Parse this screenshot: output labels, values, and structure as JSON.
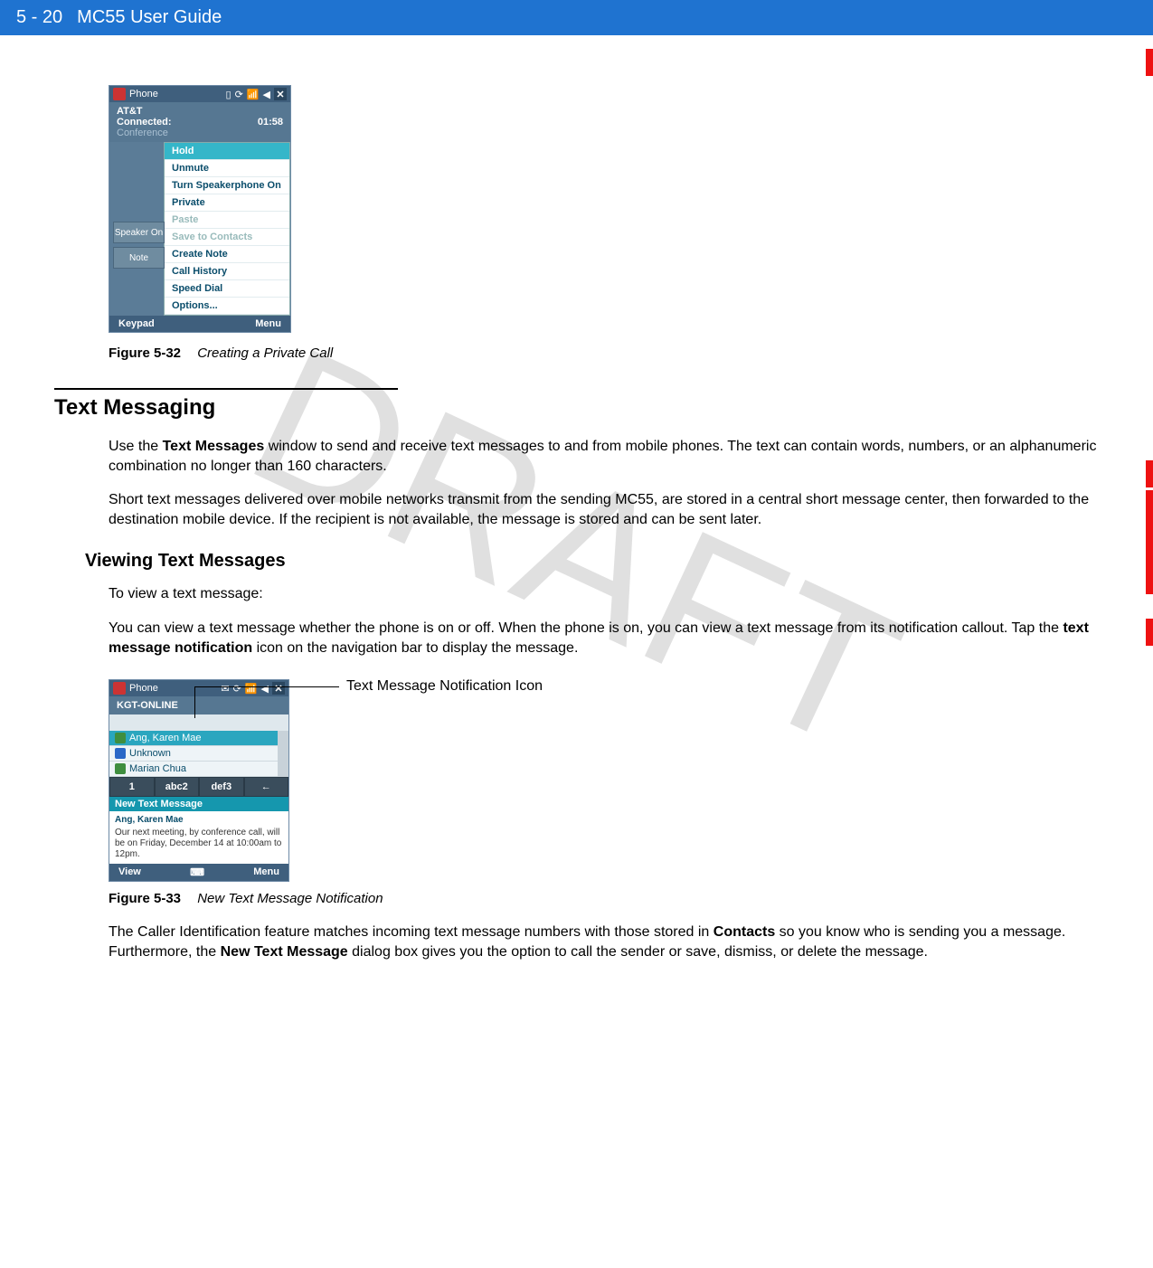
{
  "header": {
    "section": "5 - 20",
    "title": "MC55 User Guide"
  },
  "watermark": "DRAFT",
  "fig32": {
    "title": "Phone",
    "carrier": "AT&T",
    "connected": "Connected:",
    "time": "01:58",
    "conference": "Conference",
    "menu": [
      "Hold",
      "Unmute",
      "Turn Speakerphone On",
      "Private",
      "Paste",
      "Save to Contacts",
      "Create Note",
      "Call History",
      "Speed Dial",
      "Options..."
    ],
    "speaker": "Speaker On",
    "note": "Note",
    "keypad": "Keypad",
    "menubtn": "Menu",
    "caption_num": "Figure 5-32",
    "caption_txt": "Creating a Private Call"
  },
  "section_h": "Text Messaging",
  "p1a": "Use the ",
  "p1b": "Text Messages",
  "p1c": " window to send and receive text messages to and from mobile phones. The text can contain words, numbers, or an alphanumeric combination no longer than 160 characters.",
  "p2": "Short text messages delivered over mobile networks transmit from the sending MC55, are stored in a central short message center, then forwarded to the destination mobile device. If the recipient is not available, the message is stored and can be sent later.",
  "sub_h": "Viewing Text Messages",
  "p3": "To view a text message:",
  "p4a": "You can view a text message whether the phone is on or off. When the phone is on, you can view a text message from its notification callout. Tap the ",
  "p4b": "text message notification",
  "p4c": " icon on the navigation bar to display the message.",
  "callout": "Text Message Notification Icon",
  "fig33": {
    "title": "Phone",
    "kgt": "KGT-ONLINE",
    "contacts": [
      "Ang, Karen Mae",
      "Unknown",
      "Marian Chua"
    ],
    "keys": [
      "1",
      "abc2",
      "def3",
      "←"
    ],
    "newmsg_hdr": "New Text Message",
    "from": "Ang, Karen Mae",
    "body": "Our next meeting, by conference call, will be on Friday, December 14 at 10:00am to 12pm.",
    "view": "View",
    "menubtn": "Menu",
    "caption_num": "Figure 5-33",
    "caption_txt": "New Text Message Notification"
  },
  "p5a": "The Caller Identification feature matches incoming text message numbers with those stored in ",
  "p5b": "Contacts",
  "p5c": " so you know who is sending you a message. Furthermore, the ",
  "p5d": "New Text Message",
  "p5e": " dialog box gives you the option to call the sender or save, dismiss, or delete the message."
}
